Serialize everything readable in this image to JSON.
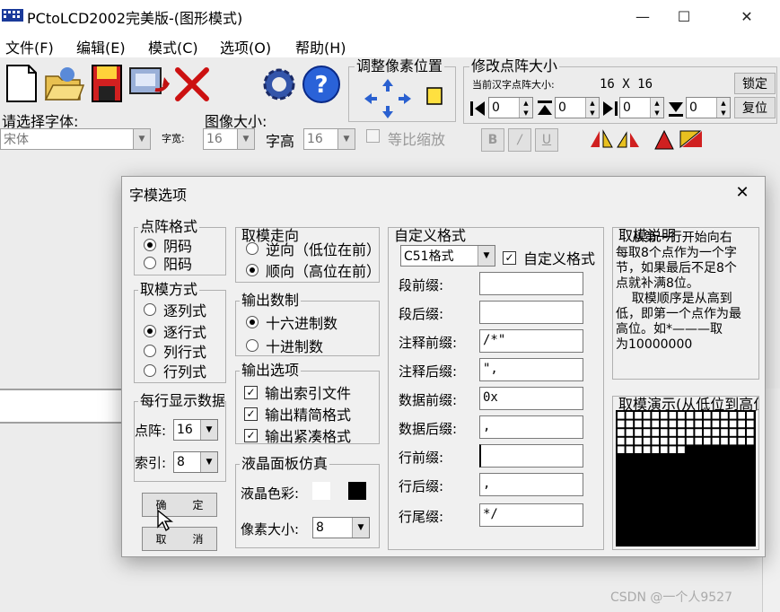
{
  "window": {
    "title": "PCtoLCD2002完美版-(图形模式)",
    "minimize": "—",
    "maximize": "☐",
    "close": "✕"
  },
  "menu": [
    "文件(F)",
    "编辑(E)",
    "模式(C)",
    "选项(O)",
    "帮助(H)"
  ],
  "toolbar": {
    "font_label": "请选择字体:",
    "font_value": "宋体",
    "width_label": "字宽:",
    "width_value": "16",
    "image_size_label": "图像大小:",
    "height_label": "字高",
    "height_value": "16",
    "proportional_label": "等比缩放",
    "adjust_pos_label": "调整像素位置",
    "resize_label": "修改点阵大小",
    "current_size_label": "当前汉字点阵大小:",
    "current_size_value": "16 X 16",
    "lock_button": "锁定",
    "reset_button": "复位",
    "spin_values": [
      "0",
      "0",
      "0",
      "0"
    ],
    "bold": "B",
    "italic": "/",
    "underline": "U"
  },
  "dialog": {
    "title": "字模选项",
    "close": "✕",
    "dot_format": {
      "title": "点阵格式",
      "options": [
        "阴码",
        "阳码"
      ],
      "selected": 0
    },
    "scan_mode": {
      "title": "取模方式",
      "options": [
        "逐列式",
        "逐行式",
        "列行式",
        "行列式"
      ],
      "selected": 1
    },
    "per_line": {
      "title": "每行显示数据",
      "dots_label": "点阵:",
      "dots_value": "16",
      "index_label": "索引:",
      "index_value": "8"
    },
    "ok_button": [
      "确",
      "定"
    ],
    "cancel_button": [
      "取",
      "消"
    ],
    "direction": {
      "title": "取模走向",
      "options": [
        "逆向（低位在前）",
        "顺向（高位在前）"
      ],
      "selected": 1
    },
    "radix": {
      "title": "输出数制",
      "options": [
        "十六进制数",
        "十进制数"
      ],
      "selected": 0
    },
    "output": {
      "title": "输出选项",
      "options": [
        "输出索引文件",
        "输出精简格式",
        "输出紧凑格式"
      ]
    },
    "lcd": {
      "title": "液晶面板仿真",
      "color_label": "液晶色彩:",
      "pixel_label": "像素大小:",
      "pixel_value": "8"
    },
    "custom": {
      "title": "自定义格式",
      "format_value": "C51格式",
      "custom_check_label": "自定义格式",
      "fields": [
        {
          "label": "段前缀:",
          "value": ""
        },
        {
          "label": "段后缀:",
          "value": ""
        },
        {
          "label": "注释前缀:",
          "value": "/*\""
        },
        {
          "label": "注释后缀:",
          "value": "\","
        },
        {
          "label": "数据前缀:",
          "value": "0x"
        },
        {
          "label": "数据后缀:",
          "value": ","
        },
        {
          "label": "行前缀:",
          "value": ""
        },
        {
          "label": "行后缀:",
          "value": ","
        },
        {
          "label": "行尾缀:",
          "value": "*/"
        }
      ]
    },
    "description": {
      "title": "取模说明",
      "text": "    从第一行开始向右\n每取8个点作为一个字\n节，如果最后不足8个\n点就补满8位。\n    取模顺序是从高到\n低，即第一个点作为最\n高位。如*———取\n为10000000"
    },
    "demo": {
      "title": "取模演示(从低位到高位)"
    }
  },
  "watermark": "CSDN @一个人9527",
  "colors": {
    "lcd_fg": "#000000",
    "lcd_bg": "#ffffff",
    "accent_red": "#cc1111",
    "gear_blue": "#3355aa"
  }
}
